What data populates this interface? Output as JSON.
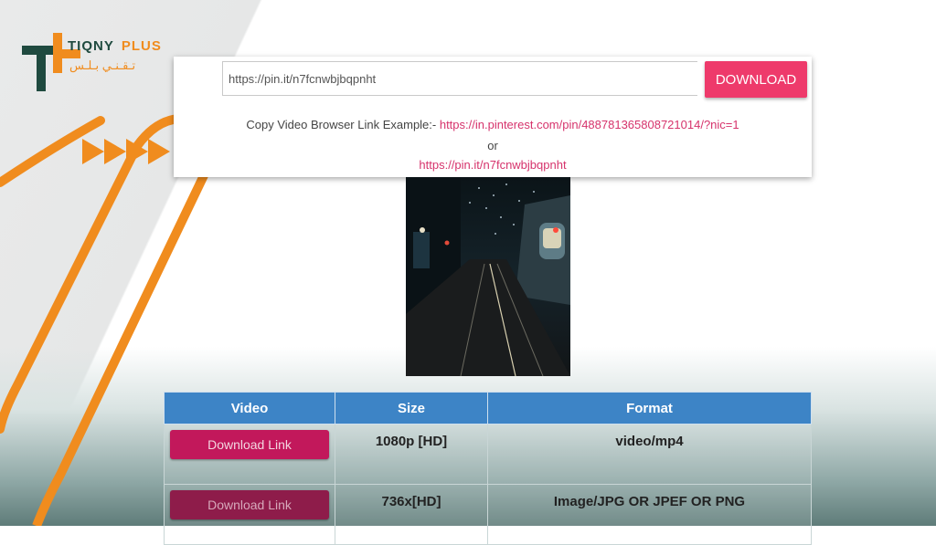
{
  "brand": {
    "name": "TIQNY",
    "name_accent": "PLUS",
    "arabic": "تـقـنـي بـلـس"
  },
  "search": {
    "url_value": "https://pin.it/n7fcnwbjbqpnht",
    "download_label": "DOWNLOAD",
    "help_prefix": "Copy Video Browser Link Example:- ",
    "example_long": "https://in.pinterest.com/pin/488781365808721014/?nic=1",
    "or_text": "or",
    "example_short": "https://pin.it/n7fcnwbjbqpnht"
  },
  "table": {
    "headers": [
      "Video",
      "Size",
      "Format"
    ],
    "rows": [
      {
        "button": "Download Link",
        "size": "1080p [HD]",
        "format": "video/mp4"
      },
      {
        "button": "Download Link",
        "size": "736x[HD]",
        "format": "Image/JPG OR JPEF OR PNG"
      }
    ]
  },
  "colors": {
    "accent_orange": "#f08c1e",
    "brand_green": "#1f4a3f",
    "download_pink": "#ee3a6b",
    "table_header_blue": "#3d84c6",
    "link_button": "#c2185b"
  },
  "icons": [
    "logo-icon",
    "play-arrows-icon"
  ]
}
